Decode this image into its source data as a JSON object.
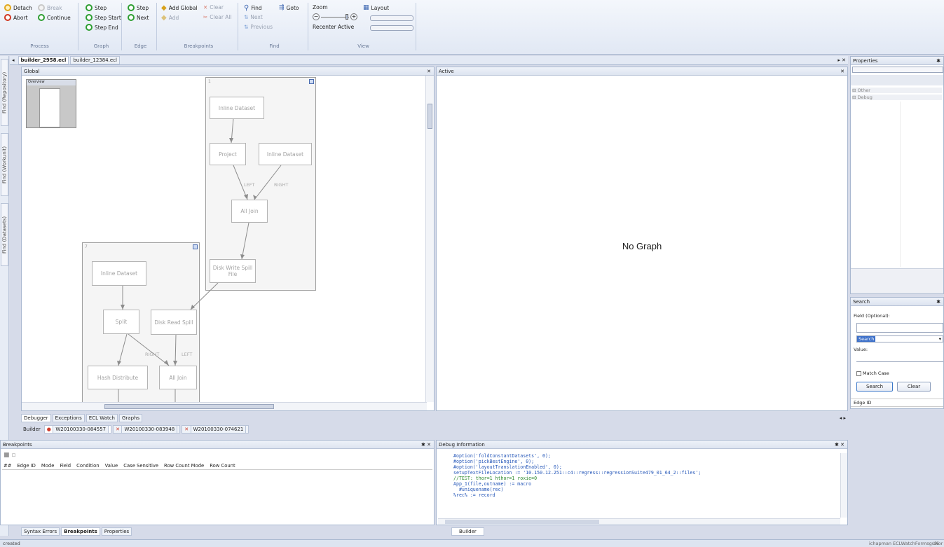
{
  "ribbon": {
    "process": {
      "title": "Process",
      "detach": "Detach",
      "break": "Break",
      "abort": "Abort",
      "continue": "Continue"
    },
    "graph": {
      "title": "Graph",
      "step": "Step",
      "step_start": "Step Start",
      "step_end": "Step End"
    },
    "edge": {
      "title": "Edge",
      "step": "Step",
      "next": "Next"
    },
    "breakpoints": {
      "title": "Breakpoints",
      "add_global": "Add Global",
      "clear": "Clear",
      "add": "Add",
      "clear_all": "Clear All"
    },
    "find": {
      "title": "Find",
      "find": "Find",
      "goto": "Goto",
      "next": "Next",
      "previous": "Previous"
    },
    "view": {
      "title": "View",
      "zoom": "Zoom",
      "recenter": "Recenter Active",
      "layout": "Layout"
    }
  },
  "side_tabs": [
    "Find (Repository)",
    "Find (Workunit)",
    "Find (Datasets)"
  ],
  "doc_tabs": [
    "builder_2958.ecl",
    "builder_12384.ecl"
  ],
  "global_pane": {
    "title": "Global",
    "overview": "Overview",
    "subgraph1_label": "1",
    "subgraph2_label": "7",
    "nodes": {
      "n1": "Inline Dataset",
      "n2": "Project",
      "n3": "Inline Dataset",
      "n4": "All Join",
      "n5": "Disk Write Spill File",
      "n6": "Inline Dataset",
      "n7": "Split",
      "n8": "Disk Read Spill",
      "n9": "Hash Distribute",
      "n10": "All Join"
    },
    "edge_labels": {
      "left1": "LEFT",
      "right1": "RIGHT",
      "right2": "RIGHT",
      "left2": "LEFT"
    }
  },
  "active_pane": {
    "title": "Active",
    "message": "No Graph"
  },
  "bottom_tabs": [
    "Debugger",
    "Exceptions",
    "ECL Watch",
    "Graphs"
  ],
  "builder_row": {
    "label": "Builder",
    "wu": [
      "W20100330-084557",
      "W20100330-083948",
      "W20100330-074621"
    ]
  },
  "breakpoints_panel": {
    "title": "Breakpoints",
    "columns": [
      "##",
      "Edge ID",
      "Mode",
      "Field",
      "Condition",
      "Value",
      "Case Sensitive",
      "Row Count Mode",
      "Row Count"
    ]
  },
  "panel_tabs": [
    "Syntax Errors",
    "Breakpoints",
    "Properties"
  ],
  "debug_info": {
    "title": "Debug Information",
    "lines": [
      "#option('foldConstantDatasets', 0);",
      "#option('pickBestEngine', 0);",
      "#option('layoutTranslationEnabled', 0);",
      "setupTextFileLocation := '10.150.12.251::c4::regress::regressionSuite479_01_64_2::files';",
      "//TEST: thor=1 hthor=1 roxie=0",
      "App_1(file,outname) := macro",
      "  #uniquename(rec)",
      "%rec% := record"
    ],
    "tab": "Builder"
  },
  "properties": {
    "title": "Properties",
    "groups": [
      "Other",
      "Debug"
    ]
  },
  "search": {
    "title": "Search",
    "field_label": "Field (Optional):",
    "mode": "Search",
    "value_label": "Value:",
    "match_case": "Match Case",
    "search_btn": "Search",
    "clear_btn": "Clear",
    "col": "Edge ID"
  },
  "status": {
    "left": "created",
    "user": "ichapman",
    "app": "ECLWatchFormsgui6",
    "right": "thor"
  }
}
